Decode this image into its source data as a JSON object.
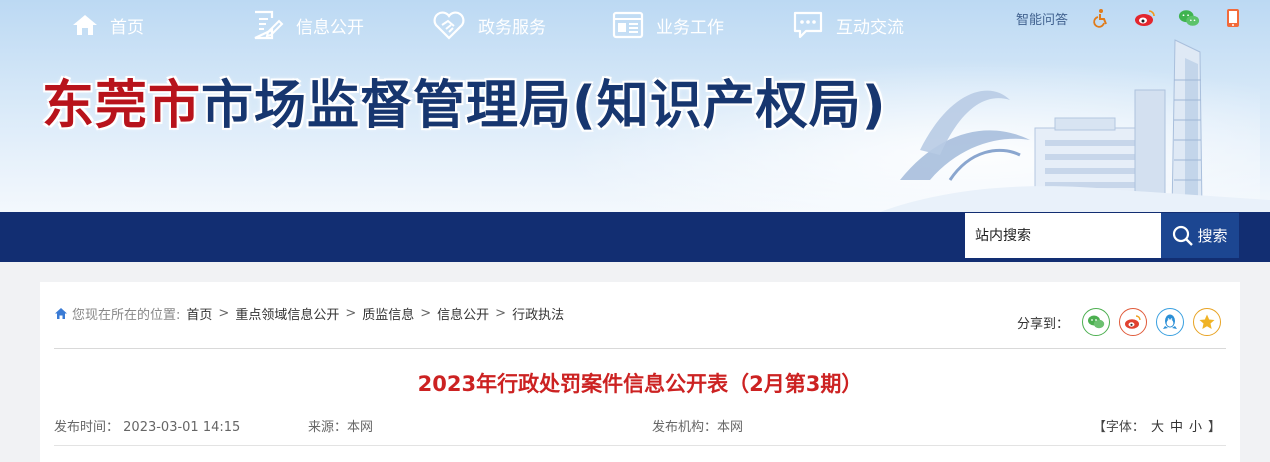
{
  "header": {
    "title_city": "东莞市",
    "title_bureau": "市场监督管理局(知识产权局)",
    "top_links": {
      "qa": "智能问答",
      "icons": [
        "accessibility-icon",
        "weibo-icon",
        "wechat-icon",
        "mobile-icon"
      ]
    }
  },
  "nav": {
    "items": [
      {
        "label": "首页",
        "icon": "home-icon"
      },
      {
        "label": "信息公开",
        "icon": "document-list-icon"
      },
      {
        "label": "政务服务",
        "icon": "heart-handshake-icon"
      },
      {
        "label": "业务工作",
        "icon": "browser-window-icon"
      },
      {
        "label": "互动交流",
        "icon": "chat-bubble-icon"
      }
    ],
    "search_placeholder": "站内搜索",
    "search_button": "搜索"
  },
  "breadcrumb": {
    "prefix": "您现在所在的位置:",
    "items": [
      "首页",
      "重点领域信息公开",
      "质监信息",
      "信息公开",
      "行政执法"
    ],
    "separator": ">"
  },
  "share": {
    "label": "分享到：",
    "icons": [
      {
        "name": "wechat-share-icon",
        "color": "#4caf50"
      },
      {
        "name": "weibo-share-icon",
        "color": "#e05a3a"
      },
      {
        "name": "qq-share-icon",
        "color": "#3aa0e0"
      },
      {
        "name": "favorite-share-icon",
        "color": "#e8a323"
      }
    ]
  },
  "article": {
    "title": "2023年行政处罚案件信息公开表（2月第3期）",
    "publish_label": "发布时间：",
    "publish_time": "2023-03-01 14:15",
    "source_label": "来源：",
    "source": "本网",
    "org_label": "发布机构：",
    "org": "本网",
    "font_label": "【字体：",
    "font_sizes": [
      "大",
      "中",
      "小"
    ],
    "font_end": "】"
  },
  "colors": {
    "nav_bg": "#122e72",
    "title_red": "#b8131b",
    "title_blue": "#17366f",
    "article_title": "#cc2222"
  }
}
